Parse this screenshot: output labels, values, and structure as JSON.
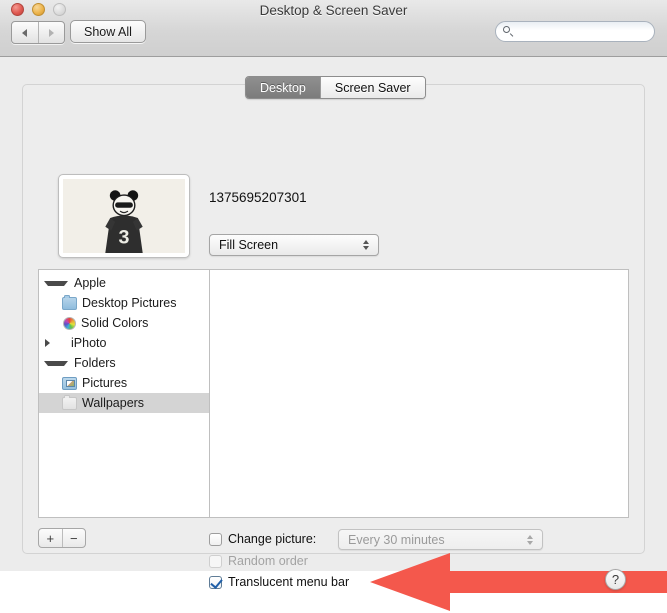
{
  "window": {
    "title": "Desktop & Screen Saver",
    "traffic_lights": [
      {
        "name": "close",
        "color": "#e05a52"
      },
      {
        "name": "minimize",
        "color": "#edb54d"
      },
      {
        "name": "zoom",
        "color": "#dddddd"
      }
    ]
  },
  "toolbar": {
    "back_icon": "triangle-left-icon",
    "forward_icon": "triangle-right-icon",
    "show_all_label": "Show All",
    "search": {
      "value": "",
      "placeholder": "",
      "icon": "search-icon"
    }
  },
  "tabs": [
    {
      "label": "Desktop",
      "active": true
    },
    {
      "label": "Screen Saver",
      "active": false
    }
  ],
  "preview": {
    "file_name": "1375695207301",
    "scaling": {
      "value": "Fill Screen",
      "stepper_icon": "stepper-updown-icon"
    },
    "thumbnail_alt": "panda-figure-wallpaper-thumbnail"
  },
  "source_list": [
    {
      "label": "Apple",
      "level": 0,
      "disclosure": "open",
      "icon": null,
      "selected": false
    },
    {
      "label": "Desktop Pictures",
      "level": 1,
      "disclosure": "none",
      "icon": "folder-icon",
      "selected": false
    },
    {
      "label": "Solid Colors",
      "level": 1,
      "disclosure": "none",
      "icon": "colors-icon",
      "selected": false
    },
    {
      "label": "iPhoto",
      "level": 0,
      "disclosure": "closed",
      "icon": null,
      "selected": false
    },
    {
      "label": "Folders",
      "level": 0,
      "disclosure": "open",
      "icon": null,
      "selected": false
    },
    {
      "label": "Pictures",
      "level": 1,
      "disclosure": "none",
      "icon": "pictures-icon",
      "selected": false
    },
    {
      "label": "Wallpapers",
      "level": 1,
      "disclosure": "none",
      "icon": "folder-plain-icon",
      "selected": true
    }
  ],
  "list_controls": {
    "add_label": "+",
    "remove_label": "−"
  },
  "options": {
    "change_picture": {
      "label": "Change picture:",
      "checked": false,
      "interval": "Every 30 minutes",
      "interval_enabled": false
    },
    "random_order": {
      "label": "Random order",
      "checked": false,
      "enabled": false
    },
    "translucent_menu_bar": {
      "label": "Translucent menu bar",
      "checked": true,
      "enabled": true
    }
  },
  "help": {
    "label": "?",
    "icon": "help-icon"
  },
  "annotation": {
    "type": "arrow-left",
    "color": "#f4584c",
    "points_to": "Translucent menu bar"
  }
}
